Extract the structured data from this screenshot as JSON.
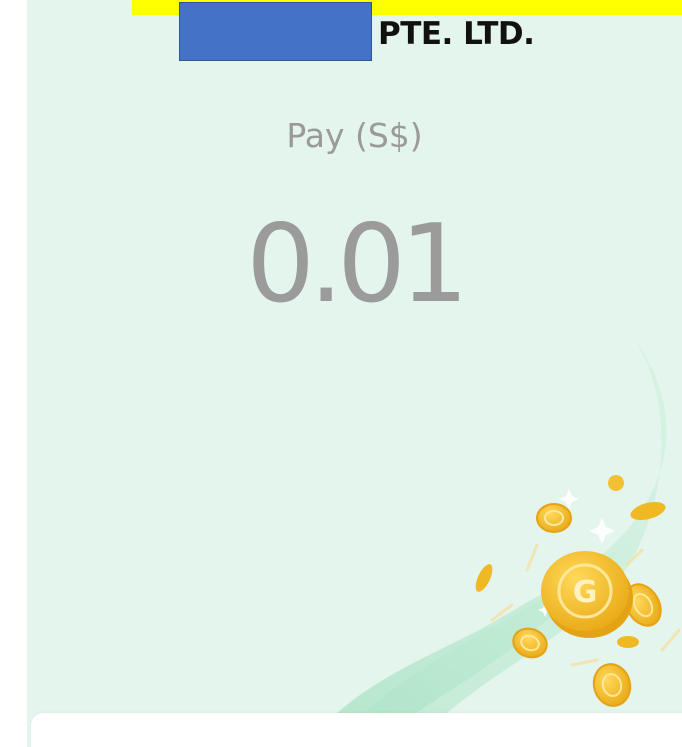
{
  "merchant": {
    "name_suffix": "PTE. LTD."
  },
  "payment": {
    "label": "Pay (S$)",
    "amount": "0.01"
  },
  "decoration": {
    "coin_letter": "G"
  },
  "colors": {
    "background": "#e3f5ec",
    "banner": "#ffff00",
    "redaction": "#4472c4",
    "text_muted": "#9a9a9a",
    "coin_gold": "#f0b823"
  }
}
